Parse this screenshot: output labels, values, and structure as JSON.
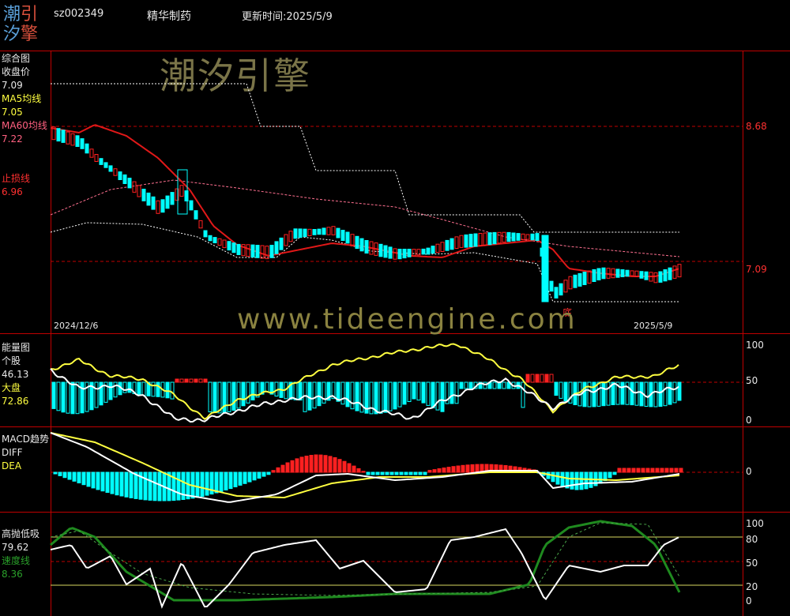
{
  "logo": {
    "chars": [
      "潮",
      "引",
      "汐",
      "擎"
    ]
  },
  "header": {
    "code": "sz002349",
    "name": "精华制药",
    "update_label": "更新时间:",
    "update_date": "2025/5/9"
  },
  "watermark": {
    "top": "潮汐引擎",
    "middle": "www.tideengine.com"
  },
  "panel1": {
    "title": "综合图",
    "close_label": "收盘价",
    "close_value": "7.09",
    "ma5_label": "MA5均线",
    "ma5_value": "7.05",
    "ma60_label": "MA60均线",
    "ma60_value": "7.22",
    "stop_label": "止损线",
    "stop_value": "6.96",
    "right_top": "8.68",
    "right_bottom": "7.09",
    "date_start": "2024/12/6",
    "date_end": "2025/5/9",
    "bottom_mark": "底"
  },
  "panel2": {
    "title": "能量图",
    "stock_label": "个股",
    "stock_value": "46.13",
    "market_label": "大盘",
    "market_value": "72.86",
    "axis": [
      "100",
      "50",
      "0"
    ]
  },
  "panel3": {
    "title": "MACD趋势",
    "diff_label": "DIFF",
    "dea_label": "DEA",
    "axis": [
      "0"
    ]
  },
  "panel4": {
    "title": "高抛低吸",
    "value": "79.62",
    "speed_label": "速度线",
    "speed_value": "8.36",
    "axis": [
      "100",
      "80",
      "50",
      "20",
      "0"
    ]
  },
  "colors": {
    "grid": "#c00000",
    "cyan": "#00ffff",
    "red": "#ff2020",
    "yellow": "#ffff40",
    "white": "#ffffff",
    "green": "#1f8a1f",
    "ma_pink": "#ff6080"
  }
}
